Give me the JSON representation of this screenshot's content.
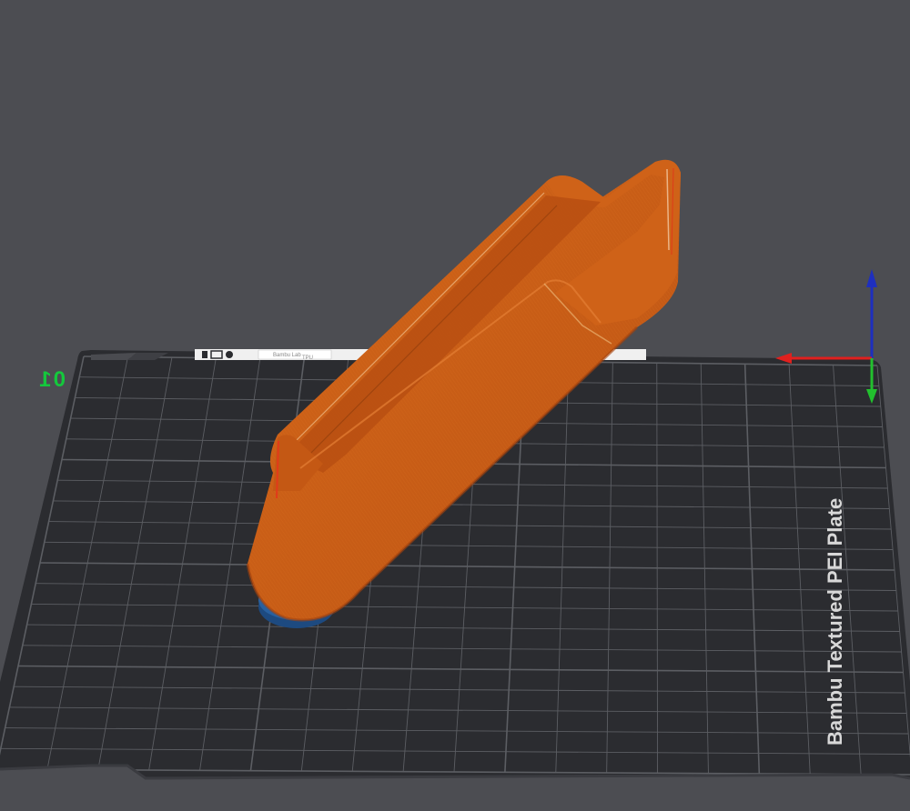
{
  "scene": {
    "plate_number": "01",
    "plate_label": "Bambu Textured PEI Plate",
    "tab_text_1": "Bambu Lab",
    "tab_text_2": "TPU",
    "model_color": "#c75a17",
    "model_highlight": "#e07428",
    "model_shadow": "#a9460f",
    "support_color": "#1f4f86",
    "plate_color": "#2b2c30",
    "grid_color": "#5c5e63",
    "background_color": "#4c4d52"
  },
  "axes": {
    "x_color": "#e0201e",
    "y_color": "#22c02e",
    "z_color": "#1e2fbf"
  }
}
